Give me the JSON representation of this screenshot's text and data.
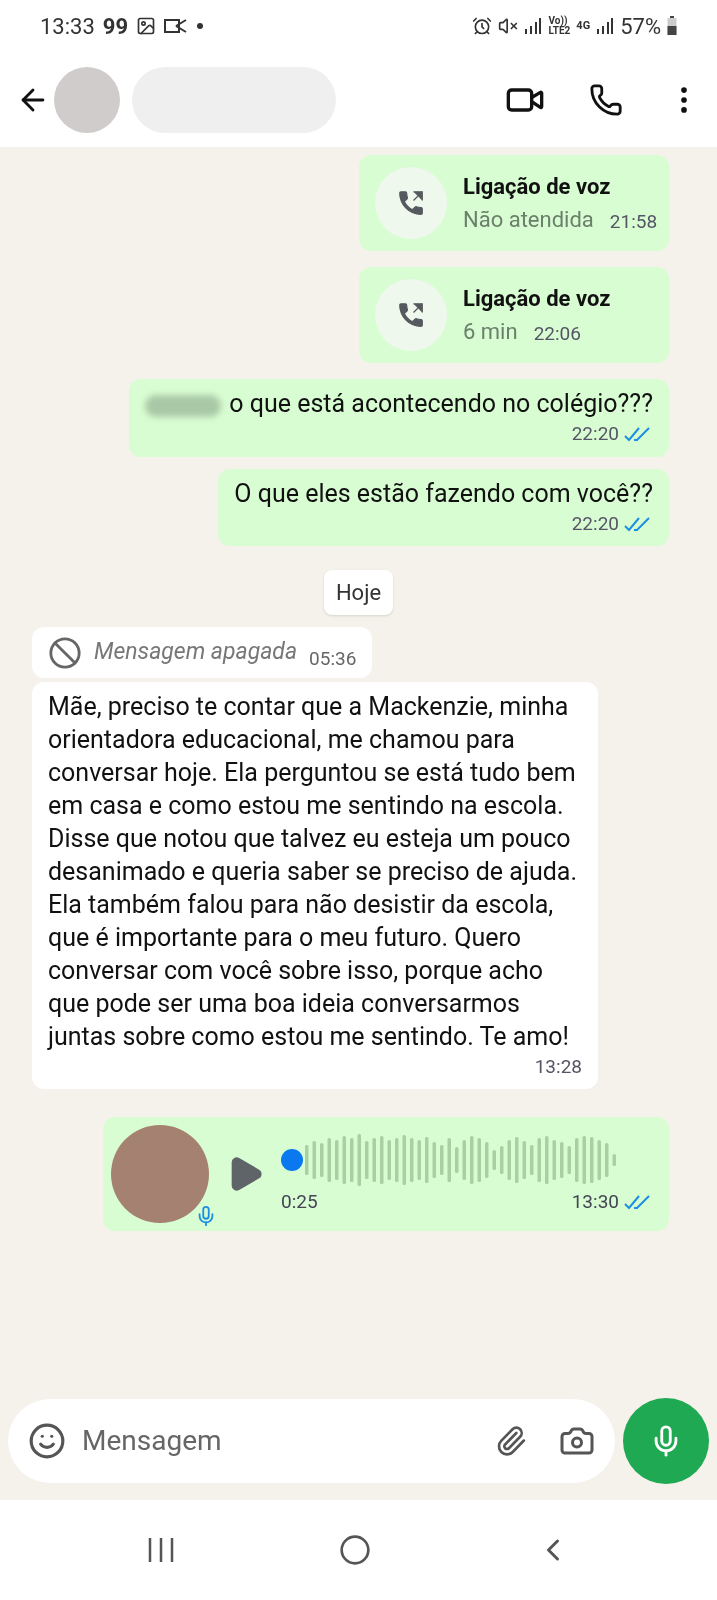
{
  "status_bar": {
    "time": "13:33",
    "notification_count": "99",
    "battery": "57%",
    "network_top": "Vo))",
    "network_bottom": "LTE2",
    "data_type": "4G"
  },
  "messages": [
    {
      "kind": "call",
      "outgoing": true,
      "title": "Ligação de voz",
      "detail": "Não atendida",
      "time": "21:58"
    },
    {
      "kind": "call",
      "outgoing": true,
      "title": "Ligação de voz",
      "detail": "6 min",
      "time": "22:06"
    },
    {
      "kind": "text",
      "outgoing": true,
      "text": "o que está acontecendo no colégio???",
      "time": "22:20",
      "read": true
    },
    {
      "kind": "text",
      "outgoing": true,
      "text": "O que eles estão fazendo com você??",
      "time": "22:20",
      "read": true
    },
    {
      "kind": "date",
      "text": "Hoje"
    },
    {
      "kind": "deleted",
      "outgoing": false,
      "text": "Mensagem apagada",
      "time": "05:36"
    },
    {
      "kind": "text",
      "outgoing": false,
      "text": "Mãe, preciso te contar que a Mackenzie, minha orientadora educacional, me chamou para conversar hoje. Ela perguntou se está tudo bem em casa e como estou me sentindo na escola. Disse que notou que talvez eu esteja um pouco desanimado e queria saber se preciso de ajuda. Ela também falou para não desistir da escola, que é importante para o meu futuro. Quero conversar com você sobre isso, porque acho que pode ser uma boa ideia conversarmos juntas sobre como estou me sentindo. Te amo!",
      "time": "13:28"
    },
    {
      "kind": "audio",
      "outgoing": true,
      "duration": "0:25",
      "time": "13:30",
      "read": true
    }
  ],
  "composer": {
    "placeholder": "Mensagem"
  }
}
